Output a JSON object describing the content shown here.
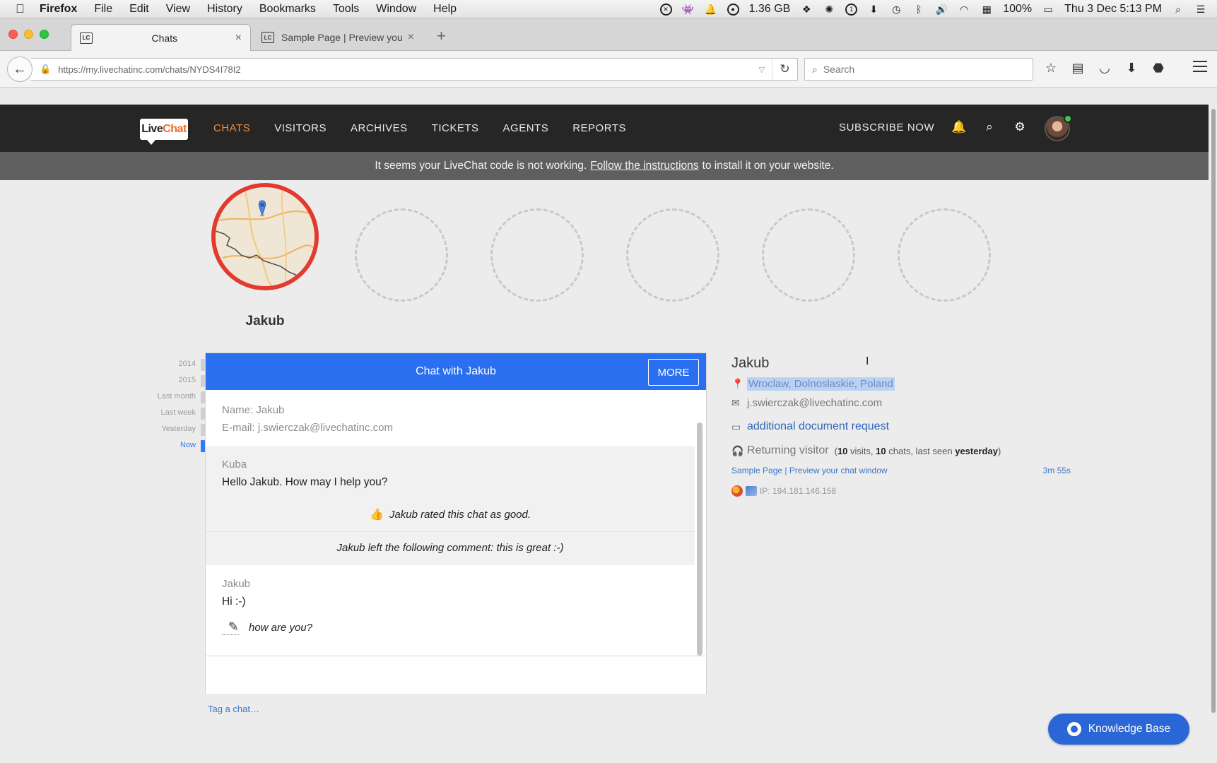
{
  "os_menubar": {
    "app_name": "Firefox",
    "menus": [
      "File",
      "Edit",
      "View",
      "History",
      "Bookmarks",
      "Tools",
      "Window",
      "Help"
    ],
    "memory": "1.36 GB",
    "battery": "100%",
    "clock": "Thu 3 Dec  5:13 PM"
  },
  "browser": {
    "tabs": [
      {
        "label": "Chats",
        "favicon": "LC"
      },
      {
        "label": "Sample Page | Preview you...",
        "favicon": "LC"
      }
    ],
    "new_tab_label": "+",
    "url": "https://my.livechatinc.com/chats/NYDS4I78I2",
    "search_placeholder": "Search"
  },
  "app": {
    "logo_live": "Live",
    "logo_chat": "Chat",
    "nav": [
      "CHATS",
      "VISITORS",
      "ARCHIVES",
      "TICKETS",
      "AGENTS",
      "REPORTS"
    ],
    "subscribe": "SUBSCRIBE NOW",
    "warning": {
      "before": "It seems your LiveChat code is not working.",
      "link": "Follow the instructions",
      "after": "to install it on your website."
    }
  },
  "visitor_card": {
    "name": "Jakub"
  },
  "timeline": [
    "2014",
    "2015",
    "Last month",
    "Last week",
    "Yesterday",
    "Now"
  ],
  "chat": {
    "title": "Chat with Jakub",
    "more_label": "MORE",
    "info_name": "Name: Jakub",
    "info_email": "E-mail: j.swierczak@livechatinc.com",
    "agent_name": "Kuba",
    "agent_message": "Hello Jakub. How may I help you?",
    "rating_text": "Jakub rated this chat as good.",
    "comment_text": "Jakub left the following comment: this is great :-)",
    "visitor_name": "Jakub",
    "visitor_message": "Hi :-)",
    "typing_text": "how are you?",
    "tag_label": "Tag a chat…"
  },
  "details": {
    "name": "Jakub",
    "location": "Wroclaw, Dolnoslaskie, Poland",
    "email": "j.swierczak@livechatinc.com",
    "ticket_link": "additional document request",
    "visitor_type": "Returning visitor",
    "visits_open": "(",
    "visits_count": "10",
    "visits_label": "visits,",
    "chats_count": "10",
    "chats_label": "chats, last seen",
    "last_seen": "yesterday",
    "visits_close": ")",
    "page_title": "Sample Page | Preview your chat window",
    "page_time": "3m 55s",
    "ip": "IP: 194.181.146.158"
  },
  "knowledge_base_label": "Knowledge Base",
  "colors": {
    "accent": "#2a6ff0",
    "nav_active": "#f58a3b",
    "avatar_ring": "#e33a2f"
  }
}
